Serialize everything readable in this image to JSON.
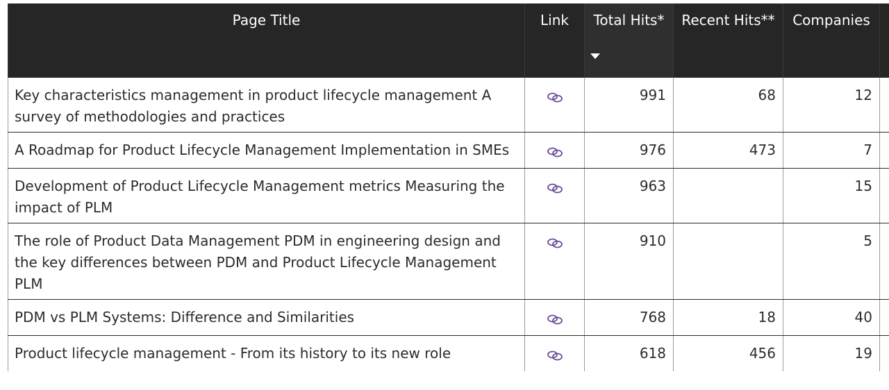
{
  "table": {
    "headers": {
      "title": "Page Title",
      "link": "Link",
      "total_hits": "Total Hits*",
      "recent_hits": "Recent Hits**",
      "companies": "Companies"
    },
    "sort": {
      "column": "total_hits",
      "direction": "descending"
    },
    "link_icon": "link-chain-icon",
    "link_icon_color": "#6a4a9a",
    "rows": [
      {
        "title": "Key characteristics management in product lifecycle management A survey of methodologies and practices",
        "total_hits": "991",
        "recent_hits": "68",
        "companies": "12"
      },
      {
        "title": "A Roadmap for Product Lifecycle Management Implementation in SMEs",
        "total_hits": "976",
        "recent_hits": "473",
        "companies": "7"
      },
      {
        "title": "Development of Product Lifecycle Management metrics Measuring the impact of PLM",
        "total_hits": "963",
        "recent_hits": "",
        "companies": "15"
      },
      {
        "title": "The role of Product Data Management PDM in engineering design and the key differences between PDM and Product Lifecycle Management PLM",
        "total_hits": "910",
        "recent_hits": "",
        "companies": "5"
      },
      {
        "title": "PDM vs PLM Systems: Difference and Similarities",
        "total_hits": "768",
        "recent_hits": "18",
        "companies": "40"
      },
      {
        "title": "Product lifecycle management - From its history to its new role",
        "total_hits": "618",
        "recent_hits": "456",
        "companies": "19"
      }
    ]
  }
}
